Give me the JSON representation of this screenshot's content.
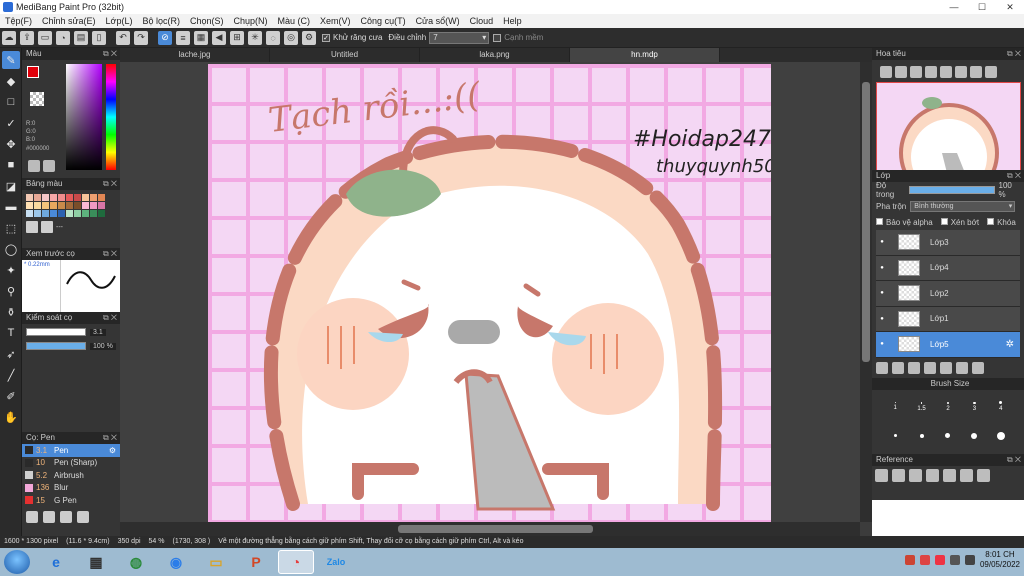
{
  "window": {
    "title": "MediBang Paint Pro (32bit)",
    "min": "—",
    "max": "☐",
    "close": "✕"
  },
  "menu": [
    "Tệp(F)",
    "Chỉnh sửa(E)",
    "Lớp(L)",
    "Bộ lọc(R)",
    "Chọn(S)",
    "Chụp(N)",
    "Màu (C)",
    "Xem(V)",
    "Công cụ(T)",
    "Cửa sổ(W)",
    "Cloud",
    "Help"
  ],
  "toolbar": {
    "antialias_label": "Khử răng cưa",
    "adjust_label": "Điều chỉnh",
    "adjust_value": "7",
    "soft_edge_label": "Cạnh mềm"
  },
  "tabs": [
    "lache.jpg",
    "Untitled",
    "laka.png",
    "hn.mdp"
  ],
  "active_tab": 3,
  "color_panel": {
    "title": "Màu",
    "r": "R:0",
    "g": "G:0",
    "b": "B:0",
    "hex": "#000000",
    "fg_color": "#e0000b"
  },
  "palette": {
    "title": "Bảng màu",
    "extra": "---",
    "colors": [
      "#f3c9b4",
      "#e8a996",
      "#f6c8c8",
      "#f7a8a8",
      "#f28d8d",
      "#e55a5a",
      "#c94a4a",
      "#f8c59a",
      "#f0a070",
      "#e38754",
      "#ffe0b3",
      "#f9d9a0",
      "#f3c37b",
      "#e8a85e",
      "#c98a4a",
      "#a36a3a",
      "#7a4e2a",
      "#f9b9d6",
      "#f09ac2",
      "#d975a6",
      "#c7dff2",
      "#9cc7ea",
      "#6fa9dd",
      "#4a8ad8",
      "#2b62b0",
      "#b9e3c6",
      "#8fcfa4",
      "#5eb37e",
      "#3a8e5a",
      "#1f6b3d"
    ]
  },
  "brush_preview": {
    "title": "Xem trước cọ",
    "size": "0.22mm"
  },
  "brush_control": {
    "title": "Kiểm soát cọ",
    "size_value": "3.1",
    "opacity_value": "100 %",
    "opacity_pct": 100
  },
  "pens": {
    "title": "Cọ: Pen",
    "items": [
      {
        "size": "3.1",
        "name": "Pen",
        "color": "#2a2a2a",
        "selected": true
      },
      {
        "size": "10",
        "name": "Pen (Sharp)",
        "color": "#2a2a2a",
        "selected": false
      },
      {
        "size": "5.2",
        "name": "Airbrush",
        "color": "#cfcfcf",
        "selected": false
      },
      {
        "size": "136",
        "name": "Blur",
        "color": "#f2a7d8",
        "selected": false
      },
      {
        "size": "15",
        "name": "G Pen",
        "color": "#e53030",
        "selected": false
      }
    ]
  },
  "canvas_art": {
    "title_text": "Tạch rồi...:((",
    "hashtag_line1": "#Hoidap247",
    "hashtag_line2": "thuyquynh50"
  },
  "navigator": {
    "title": "Hoa tiêu"
  },
  "layer_panel": {
    "title": "Lớp",
    "opacity_label": "Độ trong",
    "opacity_value": "100 %",
    "opacity_pct": 100,
    "blend_label": "Pha trộn",
    "blend_value": "Bình thường",
    "protect_alpha": "Bảo vệ alpha",
    "clipping": "Xén bớt",
    "lock": "Khóa",
    "layers": [
      {
        "name": "Lớp3",
        "selected": false
      },
      {
        "name": "Lớp4",
        "selected": false
      },
      {
        "name": "Lớp2",
        "selected": false
      },
      {
        "name": "Lớp1",
        "selected": false
      },
      {
        "name": "Lớp5",
        "selected": true
      }
    ]
  },
  "brush_size_panel": {
    "title": "Brush Size",
    "sizes": [
      "1",
      "1.5",
      "2",
      "3",
      "4"
    ]
  },
  "reference_panel": {
    "title": "Reference"
  },
  "status": {
    "dims": "1600 * 1300 pixel",
    "physical": "(11.6 * 9.4cm)",
    "dpi": "350 dpi",
    "zoom": "54 %",
    "coords": "(1730, 308 )",
    "hint": "Vẽ một đường thẳng bằng cách giữ phím Shift, Thay đổi cỡ cọ bằng cách giữ phím Ctrl, Alt và kéo"
  },
  "taskbar": {
    "time": "8:01 CH",
    "date": "09/05/2022"
  }
}
